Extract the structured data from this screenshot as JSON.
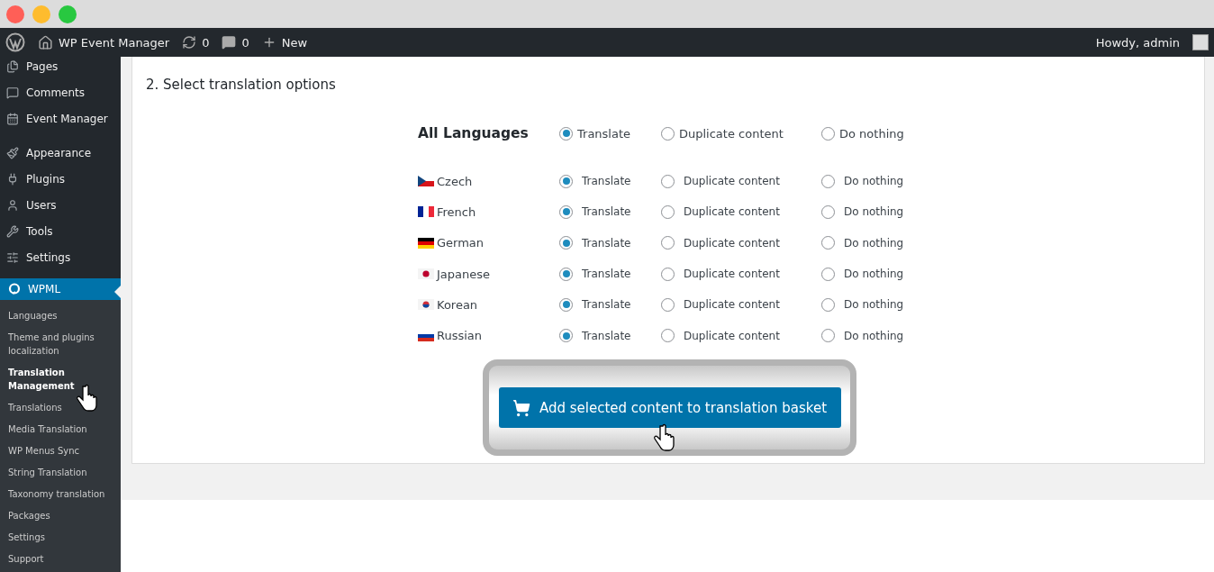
{
  "admin_bar": {
    "site_name": "WP Event Manager",
    "updates_count": "0",
    "comments_count": "0",
    "new_label": "New",
    "greeting": "Howdy, admin"
  },
  "sidebar": {
    "groups": [
      {
        "items": [
          {
            "label": "Pages"
          },
          {
            "label": "Comments"
          },
          {
            "label": "Event Manager"
          }
        ]
      },
      {
        "items": [
          {
            "label": "Appearance"
          },
          {
            "label": "Plugins"
          },
          {
            "label": "Users"
          },
          {
            "label": "Tools"
          },
          {
            "label": "Settings"
          }
        ]
      }
    ],
    "active_menu": {
      "label": "WPML"
    },
    "submenu": [
      {
        "label": "Languages",
        "selected": false
      },
      {
        "label": "Theme and plugins localization",
        "selected": false
      },
      {
        "label": "Translation Management",
        "selected": true
      },
      {
        "label": "Translations",
        "selected": false
      },
      {
        "label": "Media Translation",
        "selected": false
      },
      {
        "label": "WP Menus Sync",
        "selected": false
      },
      {
        "label": "String Translation",
        "selected": false
      },
      {
        "label": "Taxonomy translation",
        "selected": false
      },
      {
        "label": "Packages",
        "selected": false
      },
      {
        "label": "Settings",
        "selected": false
      },
      {
        "label": "Support",
        "selected": false
      }
    ]
  },
  "section": {
    "title": "2. Select translation options",
    "all_languages": {
      "label": "All Languages",
      "options": [
        {
          "label": "Translate",
          "selected": true
        },
        {
          "label": "Duplicate content",
          "selected": false
        },
        {
          "label": "Do nothing",
          "selected": false
        }
      ]
    },
    "languages": [
      {
        "name": "Czech",
        "options": [
          {
            "label": "Translate",
            "selected": true
          },
          {
            "label": "Duplicate content",
            "selected": false
          },
          {
            "label": "Do nothing",
            "selected": false
          }
        ]
      },
      {
        "name": "French",
        "options": [
          {
            "label": "Translate",
            "selected": true
          },
          {
            "label": "Duplicate content",
            "selected": false
          },
          {
            "label": "Do nothing",
            "selected": false
          }
        ]
      },
      {
        "name": "German",
        "options": [
          {
            "label": "Translate",
            "selected": true
          },
          {
            "label": "Duplicate content",
            "selected": false
          },
          {
            "label": "Do nothing",
            "selected": false
          }
        ]
      },
      {
        "name": "Japanese",
        "options": [
          {
            "label": "Translate",
            "selected": true
          },
          {
            "label": "Duplicate content",
            "selected": false
          },
          {
            "label": "Do nothing",
            "selected": false
          }
        ]
      },
      {
        "name": "Korean",
        "options": [
          {
            "label": "Translate",
            "selected": true
          },
          {
            "label": "Duplicate content",
            "selected": false
          },
          {
            "label": "Do nothing",
            "selected": false
          }
        ]
      },
      {
        "name": "Russian",
        "options": [
          {
            "label": "Translate",
            "selected": true
          },
          {
            "label": "Duplicate content",
            "selected": false
          },
          {
            "label": "Do nothing",
            "selected": false
          }
        ]
      }
    ],
    "button_label": "Add selected content to translation basket"
  }
}
